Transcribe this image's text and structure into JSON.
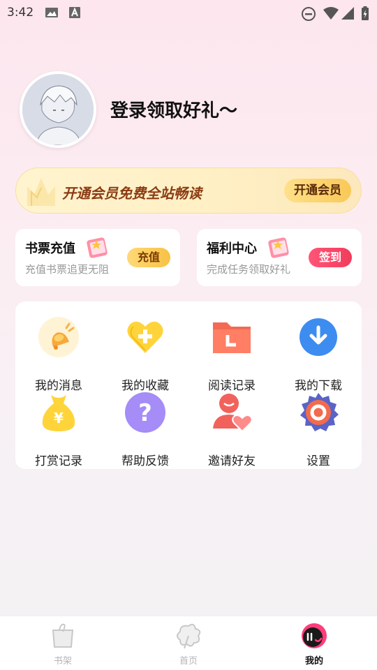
{
  "status_bar": {
    "time": "3:42"
  },
  "profile": {
    "login_text": "登录领取好礼～"
  },
  "vip": {
    "text": "开通会员免费全站畅读",
    "button": "开通会员"
  },
  "cards": [
    {
      "title": "书票充值",
      "subtitle": "充值书票追更无阻",
      "button": "充值"
    },
    {
      "title": "福利中心",
      "subtitle": "完成任务领取好礼",
      "button": "签到"
    }
  ],
  "grid": [
    {
      "label": "我的消息",
      "icon": "bell-icon"
    },
    {
      "label": "我的收藏",
      "icon": "heart-plus-icon"
    },
    {
      "label": "阅读记录",
      "icon": "folder-history-icon"
    },
    {
      "label": "我的下载",
      "icon": "download-icon"
    },
    {
      "label": "打赏记录",
      "icon": "money-bag-icon"
    },
    {
      "label": "帮助反馈",
      "icon": "help-icon"
    },
    {
      "label": "邀请好友",
      "icon": "invite-friend-icon"
    },
    {
      "label": "设置",
      "icon": "settings-gear-icon"
    }
  ],
  "bottom_nav": [
    {
      "label": "书架",
      "active": false
    },
    {
      "label": "首页",
      "active": false
    },
    {
      "label": "我的",
      "active": true
    }
  ],
  "colors": {
    "vip_text": "#8b3b12",
    "sign_button": "#f23c5c",
    "recharge_button": "#f7c244",
    "active_nav": "#111111"
  }
}
